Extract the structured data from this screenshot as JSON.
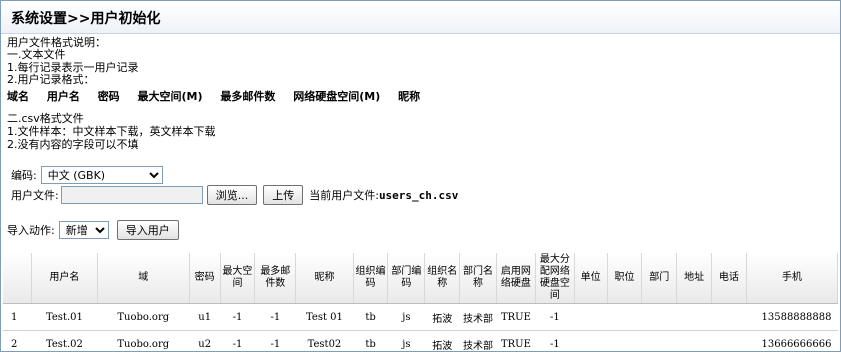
{
  "page_title": "系统设置>>用户初始化",
  "instructions": {
    "heading": "用户文件格式说明：",
    "section1_title": "一.文本文件",
    "section1_line1": "1.每行记录表示一用户记录",
    "section1_line2": "2.用户记录格式：",
    "format_fields": [
      "域名",
      "用户名",
      "密码",
      "最大空间(M)",
      "最多邮件数",
      "网络硬盘空间(M)",
      "昵称"
    ],
    "section2_title": "二.csv格式文件",
    "section2_line1": "1.文件样本：中文样本下载，英文样本下载",
    "section2_line2": "2.没有内容的字段可以不填"
  },
  "encoding": {
    "label": "编码:",
    "selected": "中文 (GBK)"
  },
  "user_file": {
    "label": "用户文件:",
    "browse_label": "浏览...",
    "upload_label": "上传",
    "current_prefix": "当前用户文件:",
    "current_file": "users_ch.csv"
  },
  "import": {
    "label": "导入动作:",
    "selected": "新增",
    "button_label": "导入用户"
  },
  "table": {
    "headers": [
      "",
      "用户名",
      "域",
      "密码",
      "最大空间",
      "最多邮件数",
      "昵称",
      "组织编码",
      "部门编码",
      "组织名称",
      "部门名称",
      "启用网络硬盘",
      "最大分配网络硬盘空间",
      "单位",
      "职位",
      "部门",
      "地址",
      "电话",
      "手机"
    ],
    "rows": [
      [
        "1",
        "Test.01",
        "Tuobo.org",
        "u1",
        "-1",
        "-1",
        "Test 01",
        "tb",
        "js",
        "拓波",
        "技术部",
        "TRUE",
        "-1",
        "",
        "",
        "",
        "",
        "",
        "13588888888"
      ],
      [
        "2",
        "Test.02",
        "Tuobo.org",
        "u2",
        "-1",
        "-1",
        "Test02",
        "tb",
        "js",
        "拓波",
        "技术部",
        "TRUE",
        "-1",
        "",
        "",
        "",
        "",
        "",
        "13666666666"
      ]
    ]
  }
}
